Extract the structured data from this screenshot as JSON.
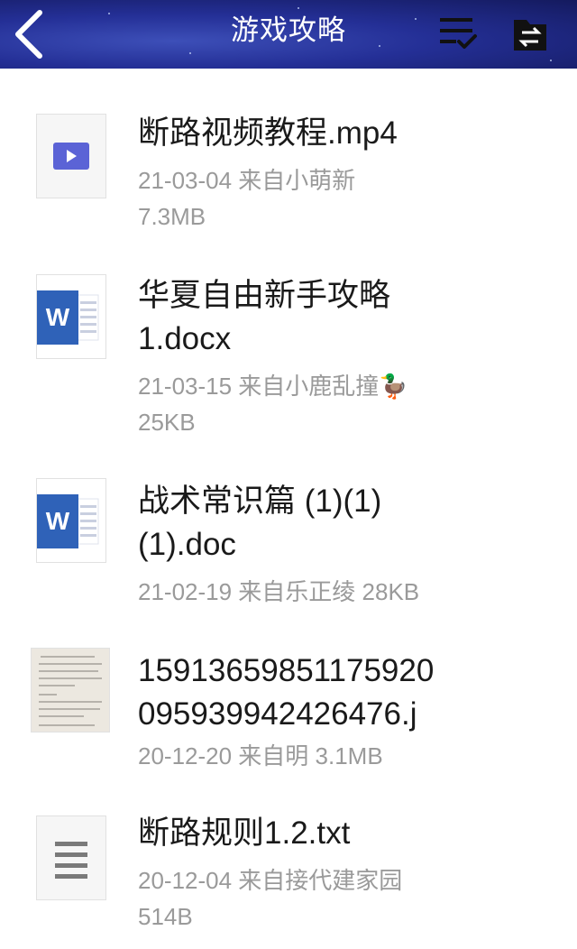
{
  "header": {
    "title": "游戏攻略"
  },
  "files": [
    {
      "icon": "video-file-icon",
      "name_lines": [
        "断路视频教程.mp4"
      ],
      "meta_lines": [
        "21-03-04 来自小萌新",
        "7.3MB"
      ]
    },
    {
      "icon": "word-doc-icon",
      "name_lines": [
        "华夏自由新手攻略",
        "1.docx"
      ],
      "meta_lines": [
        "21-03-15 来自小鹿乱撞🦆",
        "25KB"
      ]
    },
    {
      "icon": "word-doc-icon",
      "name_lines": [
        "战术常识篇 (1)(1)",
        "(1).doc"
      ],
      "meta_lines": [
        "21-02-19 来自乐正绫 28KB"
      ]
    },
    {
      "icon": "image-thumbnail",
      "name_lines": [
        "15913659851175920",
        "095939942426476.j"
      ],
      "meta_lines": [
        "20-12-20 来自明 3.1MB"
      ]
    },
    {
      "icon": "text-file-icon",
      "name_lines": [
        "断路规则1.2.txt"
      ],
      "meta_lines": [
        "20-12-04 来自接代建家园",
        "514B"
      ]
    }
  ]
}
